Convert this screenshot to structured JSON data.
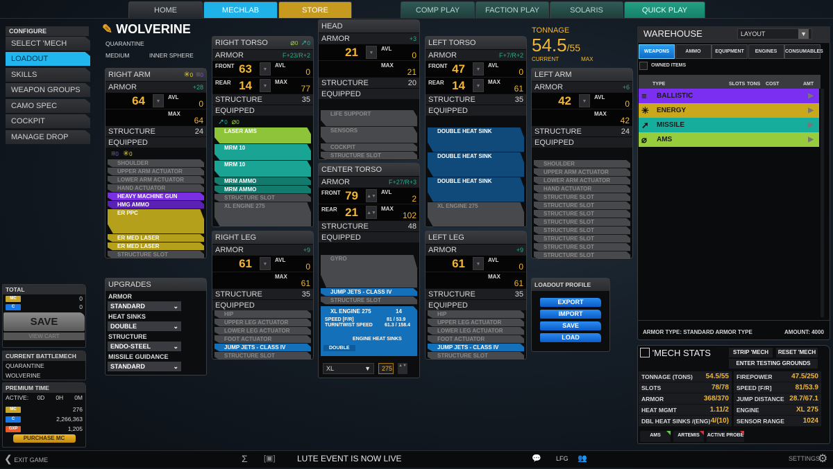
{
  "top_tabs": {
    "left": [
      "HOME",
      "MECHLAB",
      "STORE"
    ],
    "right": [
      "COMP PLAY",
      "FACTION PLAY",
      "SOLARIS",
      "QUICK PLAY"
    ],
    "active": "MECHLAB"
  },
  "sidebar": {
    "header": "CONFIGURE",
    "items": [
      "SELECT 'MECH",
      "LOADOUT",
      "SKILLS",
      "WEAPON GROUPS",
      "CAMO SPEC",
      "COCKPIT",
      "MANAGE DROP DECKS"
    ],
    "active": "LOADOUT"
  },
  "mech": {
    "name": "WOLVERINE",
    "variant": "QUARANTINE",
    "weight_class": "MEDIUM",
    "faction": "INNER SPHERE"
  },
  "labels": {
    "armor": "ARMOR",
    "structure": "STRUCTURE",
    "equipped": "EQUIPPED",
    "avl": "AVL",
    "max": "MAX",
    "front": "FRONT",
    "rear": "REAR"
  },
  "parts": {
    "right_arm": {
      "title": "RIGHT ARM",
      "header_icons": [
        {
          "icon": "energy-icon",
          "count": "0"
        },
        {
          "icon": "ballistic-icon",
          "count": "0"
        }
      ],
      "armor_bonus": "+28",
      "armor": [
        {
          "value": "64",
          "avl": "0"
        }
      ],
      "max": "64",
      "structure": "24",
      "equip_icons": [
        {
          "icon": "ballistic-icon",
          "count": "0"
        },
        {
          "icon": "energy-icon",
          "count": "0"
        }
      ],
      "items": [
        {
          "label": "SHOULDER",
          "type": "fixed",
          "slots": 1
        },
        {
          "label": "UPPER ARM ACTUATOR",
          "type": "fixed",
          "slots": 1
        },
        {
          "label": "LOWER ARM ACTUATOR",
          "type": "fixed",
          "slots": 1
        },
        {
          "label": "HAND ACTUATOR",
          "type": "fixed",
          "slots": 1
        },
        {
          "label": "HEAVY MACHINE GUN",
          "type": "ballistic",
          "slots": 1
        },
        {
          "label": "HMG AMMO",
          "type": "ballistic-ammo",
          "slots": 1
        },
        {
          "label": "ER PPC",
          "type": "energy",
          "slots": 3
        },
        {
          "label": "ER MED LASER",
          "type": "energy",
          "slots": 1
        },
        {
          "label": "ER MED LASER",
          "type": "energy",
          "slots": 1
        },
        {
          "label": "STRUCTURE SLOT",
          "type": "fixed",
          "slots": 1
        }
      ]
    },
    "right_torso": {
      "title": "RIGHT TORSO",
      "header_icons": [
        {
          "icon": "ams-icon",
          "count": "0"
        },
        {
          "icon": "missile-icon",
          "count": "0"
        }
      ],
      "armor_bonus": "F+23/R+2",
      "armor": [
        {
          "label": "FRONT",
          "value": "63",
          "avl": "0"
        },
        {
          "label": "REAR",
          "value": "14"
        }
      ],
      "max": "77",
      "structure": "35",
      "equip_icons": [
        {
          "icon": "missile-icon",
          "count": "0"
        },
        {
          "icon": "ams-icon",
          "count": "0"
        }
      ],
      "items": [
        {
          "label": "LASER AMS",
          "type": "ams",
          "slots": 2
        },
        {
          "label": "MRM 10",
          "type": "missile",
          "slots": 2
        },
        {
          "label": "MRM 10",
          "type": "missile",
          "slots": 2
        },
        {
          "label": "MRM AMMO",
          "type": "missile-ammo",
          "slots": 1
        },
        {
          "label": "MRM AMMO",
          "type": "missile-ammo",
          "slots": 1
        },
        {
          "label": "STRUCTURE SLOT",
          "type": "fixed",
          "slots": 1
        },
        {
          "label": "XL ENGINE 275",
          "type": "fixed",
          "slots": 3
        }
      ]
    },
    "head": {
      "title": "HEAD",
      "armor_bonus": "+3",
      "armor": [
        {
          "value": "21",
          "avl": "0"
        }
      ],
      "max": "21",
      "structure": "20",
      "items": [
        {
          "label": "LIFE SUPPORT",
          "type": "fixed",
          "slots": 2
        },
        {
          "label": "SENSORS",
          "type": "fixed",
          "slots": 2
        },
        {
          "label": "COCKPIT",
          "type": "fixed",
          "slots": 1
        },
        {
          "label": "STRUCTURE SLOT",
          "type": "fixed",
          "slots": 1
        }
      ]
    },
    "center_torso": {
      "title": "CENTER TORSO",
      "armor_bonus": "F+27/R+3",
      "armor": [
        {
          "label": "FRONT",
          "value": "79",
          "avl": "2"
        },
        {
          "label": "REAR",
          "value": "21"
        }
      ],
      "max": "102",
      "structure": "48",
      "items": [
        {
          "label": "GYRO",
          "type": "fixed",
          "slots": 4
        },
        {
          "label": "JUMP JETS - CLASS IV",
          "type": "equip",
          "slots": 1
        },
        {
          "label": "STRUCTURE SLOT",
          "type": "fixed",
          "slots": 1
        }
      ],
      "engine": {
        "name": "XL ENGINE 275",
        "count": "14",
        "speed_label": "SPEED [F/R]",
        "speed_value": "81 / 53.9",
        "turn_label": "TURN/TWIST SPEED",
        "turn_value": "61.3 / 158.4",
        "heat_sinks_label": "ENGINE HEAT SINKS",
        "heat_sinks_value": "DOUBLE"
      },
      "engine_type": "XL",
      "engine_rating": "275"
    },
    "left_torso": {
      "title": "LEFT TORSO",
      "armor_bonus": "F+7/R+2",
      "armor": [
        {
          "label": "FRONT",
          "value": "47",
          "avl": "0"
        },
        {
          "label": "REAR",
          "value": "14"
        }
      ],
      "max": "61",
      "structure": "35",
      "items": [
        {
          "label": "DOUBLE HEAT SINK",
          "type": "hs",
          "slots": 3
        },
        {
          "label": "DOUBLE HEAT SINK",
          "type": "hs",
          "slots": 3
        },
        {
          "label": "DOUBLE HEAT SINK",
          "type": "hs",
          "slots": 3
        },
        {
          "label": "XL ENGINE 275",
          "type": "fixed",
          "slots": 3
        }
      ]
    },
    "left_arm": {
      "title": "LEFT ARM",
      "armor_bonus": "+6",
      "armor": [
        {
          "value": "42",
          "avl": "0"
        }
      ],
      "max": "42",
      "structure": "24",
      "items": [
        {
          "label": "SHOULDER",
          "type": "fixed",
          "slots": 1
        },
        {
          "label": "UPPER ARM ACTUATOR",
          "type": "fixed",
          "slots": 1
        },
        {
          "label": "LOWER ARM ACTUATOR",
          "type": "fixed",
          "slots": 1
        },
        {
          "label": "HAND ACTUATOR",
          "type": "fixed",
          "slots": 1
        },
        {
          "label": "STRUCTURE SLOT",
          "type": "fixed",
          "slots": 1
        },
        {
          "label": "STRUCTURE SLOT",
          "type": "fixed",
          "slots": 1
        },
        {
          "label": "STRUCTURE SLOT",
          "type": "fixed",
          "slots": 1
        },
        {
          "label": "STRUCTURE SLOT",
          "type": "fixed",
          "slots": 1
        },
        {
          "label": "STRUCTURE SLOT",
          "type": "fixed",
          "slots": 1
        },
        {
          "label": "STRUCTURE SLOT",
          "type": "fixed",
          "slots": 1
        },
        {
          "label": "STRUCTURE SLOT",
          "type": "fixed",
          "slots": 1
        },
        {
          "label": "STRUCTURE SLOT",
          "type": "fixed",
          "slots": 1
        }
      ]
    },
    "right_leg": {
      "title": "RIGHT LEG",
      "armor_bonus": "+9",
      "armor": [
        {
          "value": "61",
          "avl": "0"
        }
      ],
      "max": "61",
      "structure": "35",
      "items": [
        {
          "label": "HIP",
          "type": "fixed",
          "slots": 1
        },
        {
          "label": "UPPER LEG ACTUATOR",
          "type": "fixed",
          "slots": 1
        },
        {
          "label": "LOWER LEG ACTUATOR",
          "type": "fixed",
          "slots": 1
        },
        {
          "label": "FOOT ACTUATOR",
          "type": "fixed",
          "slots": 1
        },
        {
          "label": "JUMP JETS - CLASS IV",
          "type": "equip",
          "slots": 1
        },
        {
          "label": "STRUCTURE SLOT",
          "type": "fixed",
          "slots": 1
        }
      ]
    },
    "left_leg": {
      "title": "LEFT LEG",
      "armor_bonus": "+9",
      "armor": [
        {
          "value": "61",
          "avl": "0"
        }
      ],
      "max": "61",
      "structure": "35",
      "items": [
        {
          "label": "HIP",
          "type": "fixed",
          "slots": 1
        },
        {
          "label": "UPPER LEG ACTUATOR",
          "type": "fixed",
          "slots": 1
        },
        {
          "label": "LOWER LEG ACTUATOR",
          "type": "fixed",
          "slots": 1
        },
        {
          "label": "FOOT ACTUATOR",
          "type": "fixed",
          "slots": 1
        },
        {
          "label": "JUMP JETS - CLASS IV",
          "type": "equip",
          "slots": 1
        },
        {
          "label": "STRUCTURE SLOT",
          "type": "fixed",
          "slots": 1
        }
      ]
    }
  },
  "tonnage": {
    "label": "TONNAGE",
    "current": "54.5",
    "max": "/55",
    "current_label": "CURRENT",
    "max_label": "MAX"
  },
  "upgrades": {
    "title": "UPGRADES",
    "fields": [
      {
        "label": "ARMOR",
        "value": "STANDARD"
      },
      {
        "label": "HEAT SINKS",
        "value": "DOUBLE"
      },
      {
        "label": "STRUCTURE",
        "value": "ENDO-STEEL"
      },
      {
        "label": "MISSILE GUIDANCE",
        "value": "STANDARD"
      }
    ]
  },
  "loadout_profile": {
    "title": "LOADOUT PROFILE",
    "buttons": [
      "EXPORT",
      "IMPORT",
      "SAVE",
      "LOAD"
    ]
  },
  "warehouse": {
    "title": "WAREHOUSE",
    "layout_select": "LAYOUT",
    "tabs": [
      "WEAPONS",
      "AMMO",
      "EQUIPMENT",
      "ENGINES",
      "CONSUMABLES"
    ],
    "active_tab": "WEAPONS",
    "owned_items": "OWNED ITEMS",
    "owned_checked": false,
    "columns": [
      "TYPE",
      "SLOTS",
      "TONS",
      "COST",
      "AMT"
    ],
    "rows": [
      {
        "label": "BALLISTIC",
        "icon": "ballistic-icon",
        "color": "#7b2ff0"
      },
      {
        "label": "ENERGY",
        "icon": "energy-icon",
        "color": "#c9a81c"
      },
      {
        "label": "MISSILE",
        "icon": "missile-icon",
        "color": "#17ad9c"
      },
      {
        "label": "AMS",
        "icon": "ams-icon",
        "color": "#97cc3c"
      }
    ],
    "armor_type": "ARMOR TYPE: STANDARD ARMOR TYPE",
    "amount": "AMOUNT: 4000"
  },
  "mech_stats": {
    "title": "'MECH STATS",
    "strip": "STRIP 'MECH",
    "reset": "RESET 'MECH",
    "testing": "ENTER TESTING GROUNDS",
    "left": [
      {
        "label": "TONNAGE (TONS)",
        "value": "54.5/55"
      },
      {
        "label": "SLOTS",
        "value": "78/78"
      },
      {
        "label": "ARMOR",
        "value": "368/370"
      },
      {
        "label": "HEAT MGMT",
        "value": "1.11/2"
      },
      {
        "label": "DBL HEAT SINKS /(ENG)",
        "value": "4/(10)"
      }
    ],
    "right": [
      {
        "label": "FIREPOWER",
        "value": "47.5/250"
      },
      {
        "label": "SPEED [F/R]",
        "value": "81/53.9"
      },
      {
        "label": "JUMP DISTANCE",
        "value": "28.7/67.1"
      },
      {
        "label": "ENGINE",
        "value": "XL 275"
      },
      {
        "label": "SENSOR RANGE",
        "value": "1024"
      }
    ],
    "features": [
      {
        "label": "AMS",
        "status_color": "#5ad33a"
      },
      {
        "label": "ARTEMIS",
        "status_color": "#e03030"
      },
      {
        "label": "ACTIVE PROBE",
        "status_color": "#e03030"
      }
    ]
  },
  "total": {
    "title": "TOTAL",
    "mc": "0",
    "cbills": "0",
    "save": "SAVE",
    "view_cart": "VIEW CART"
  },
  "current_mech": {
    "title": "CURRENT BATTLEMECH",
    "variant": "QUARANTINE",
    "name": "WOLVERINE"
  },
  "premium": {
    "title": "PREMIUM TIME",
    "active_label": "ACTIVE:",
    "days": "0D",
    "hours": "0H",
    "minutes": "0M",
    "mc": "276",
    "cbills": "2,266,363",
    "gxp": "1,205",
    "purchase": "PURCHASE MC",
    "mc_tag": "MC",
    "cb_tag": "C",
    "gxp_tag": "GXP"
  },
  "bottom": {
    "exit": "EXIT GAME",
    "event": "LUTE EVENT IS NOW LIVE",
    "lfg": "LFG",
    "settings": "SETTINGS"
  }
}
